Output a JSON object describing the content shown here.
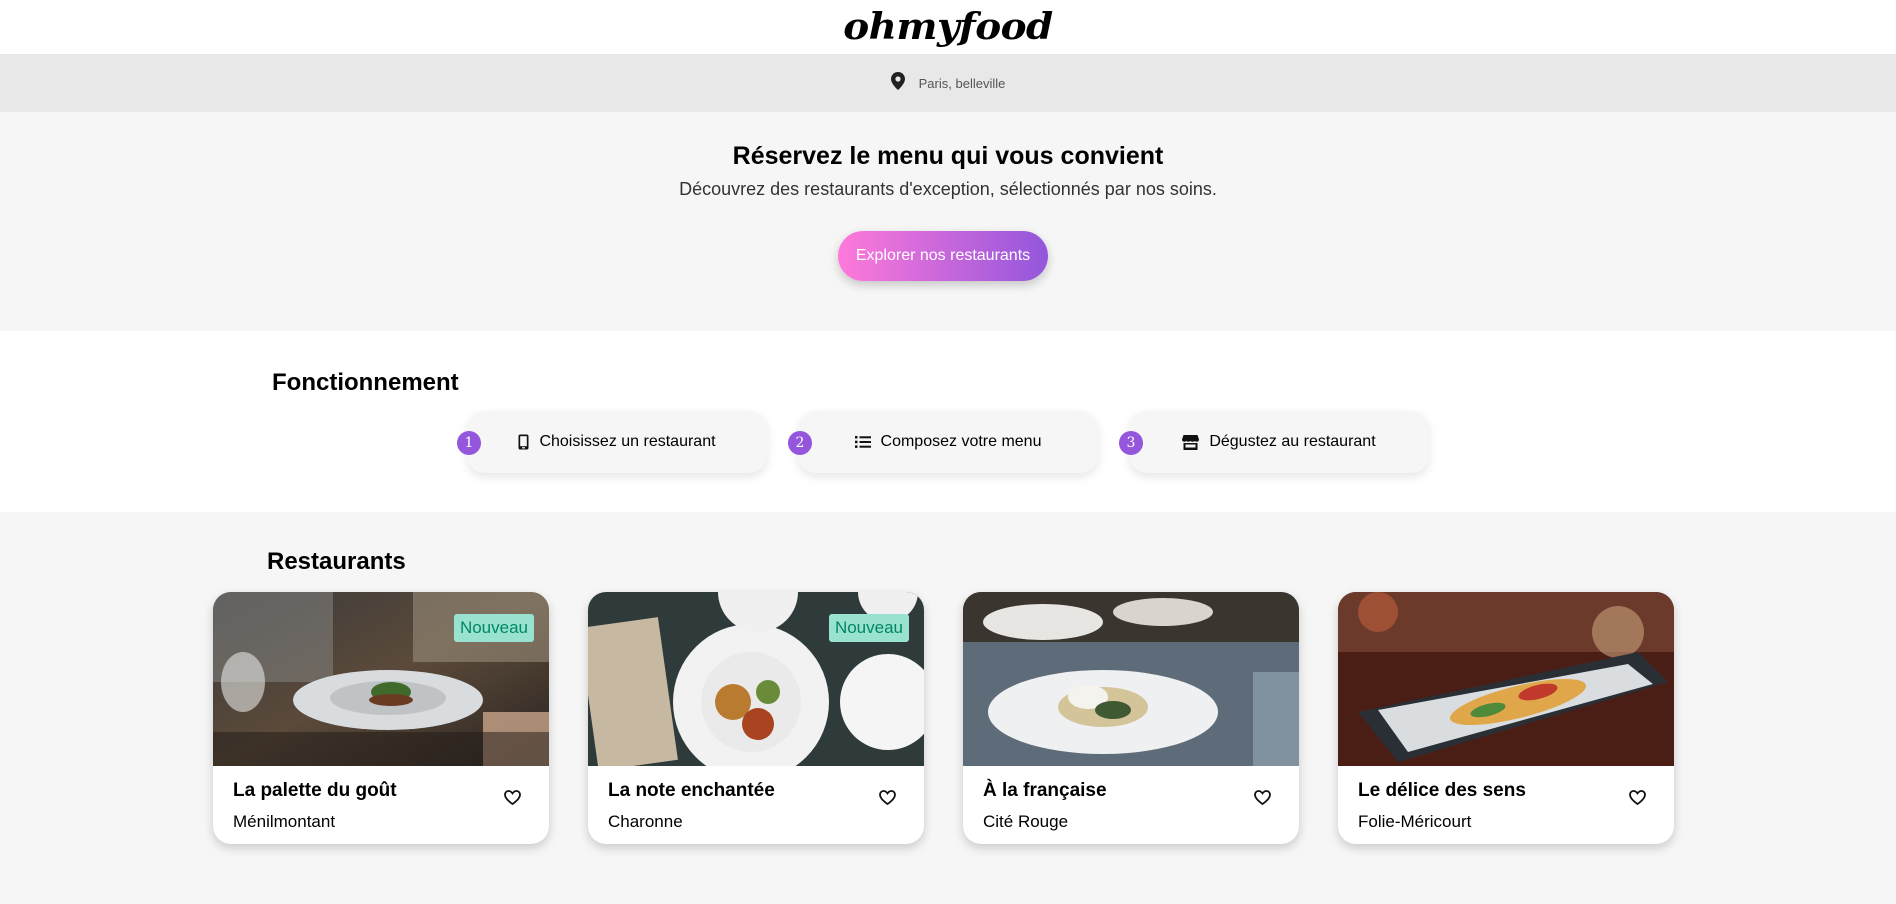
{
  "header": {
    "logo": "ohmyfood"
  },
  "location": {
    "text": "Paris, belleville",
    "icon": "location-pin-icon"
  },
  "hero": {
    "title": "Réservez le menu qui vous convient",
    "subtitle": "Découvrez des restaurants d'exception, sélectionnés par nos soins.",
    "button_label": "Explorer nos restaurants",
    "button_gradient": [
      "#ff79da",
      "#9356dc"
    ]
  },
  "how": {
    "title": "Fonctionnement",
    "steps": [
      {
        "number": "1",
        "label": "Choisissez un restaurant",
        "icon": "mobile-phone-icon"
      },
      {
        "number": "2",
        "label": "Composez votre menu",
        "icon": "list-icon"
      },
      {
        "number": "3",
        "label": "Dégustez au restaurant",
        "icon": "store-icon"
      }
    ]
  },
  "restaurants": {
    "title": "Restaurants",
    "items": [
      {
        "name": "La palette du goût",
        "area": "Ménilmontant",
        "badge": "Nouveau"
      },
      {
        "name": "La note enchantée",
        "area": "Charonne",
        "badge": "Nouveau"
      },
      {
        "name": "À la française",
        "area": "Cité Rouge"
      },
      {
        "name": "Le délice des sens",
        "area": "Folie-Méricourt"
      }
    ]
  },
  "colors": {
    "accent": "#9356dc",
    "badge_bg": "#99e2d0",
    "badge_text": "#008766"
  }
}
